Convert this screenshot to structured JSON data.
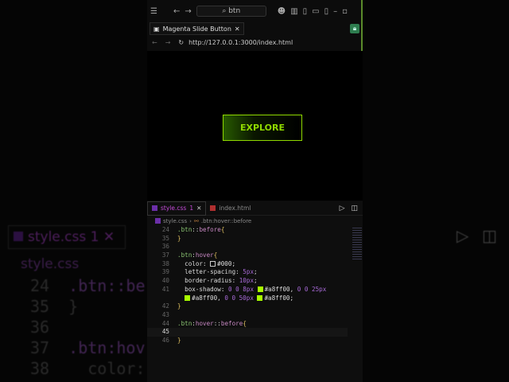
{
  "window": {
    "search": "btn",
    "tab_title": "Magenta Slide Button",
    "url": "http://127.0.0.1:3000/index.html"
  },
  "page": {
    "button_label": "EXPLORE",
    "accent": "#a8ff00"
  },
  "editor": {
    "tabs": [
      {
        "label": "style.css",
        "badge": "1"
      },
      {
        "label": "index.html"
      }
    ],
    "breadcrumb": {
      "file": "style.css",
      "symbol": ".btn:hover::before"
    },
    "lines": [
      {
        "num": "24",
        "tokens": [
          {
            "t": ".btn",
            "c": "#88c070"
          },
          {
            "t": "::",
            "c": "#ccc"
          },
          {
            "t": "before",
            "c": "#c586c0"
          },
          {
            "t": "{",
            "c": "#e0c060"
          }
        ]
      },
      {
        "num": "35",
        "tokens": [
          {
            "t": "}",
            "c": "#e0c060"
          }
        ]
      },
      {
        "num": "36",
        "tokens": []
      },
      {
        "num": "37",
        "tokens": [
          {
            "t": ".btn",
            "c": "#88c070"
          },
          {
            "t": ":",
            "c": "#ccc"
          },
          {
            "t": "hover",
            "c": "#c586c0"
          },
          {
            "t": "{",
            "c": "#e0c060"
          }
        ]
      },
      {
        "num": "38",
        "tokens": [
          {
            "t": "  color: ",
            "c": "#ddd"
          },
          {
            "sw": "#000000"
          },
          {
            "t": "#000",
            "c": "#ddd"
          },
          {
            "t": ";",
            "c": "#ddd"
          }
        ]
      },
      {
        "num": "39",
        "tokens": [
          {
            "t": "  letter-spacing: ",
            "c": "#ddd"
          },
          {
            "t": "5px",
            "c": "#a86ad8"
          },
          {
            "t": ";",
            "c": "#ddd"
          }
        ]
      },
      {
        "num": "40",
        "tokens": [
          {
            "t": "  border-radius: ",
            "c": "#ddd"
          },
          {
            "t": "10px",
            "c": "#a86ad8"
          },
          {
            "t": ";",
            "c": "#ddd"
          }
        ]
      },
      {
        "num": "41",
        "tokens": [
          {
            "t": "  box-shadow: ",
            "c": "#ddd"
          },
          {
            "t": "0 0 8px ",
            "c": "#a86ad8"
          },
          {
            "sw": "#a8ff00"
          },
          {
            "t": "#a8ff00, ",
            "c": "#ddd"
          },
          {
            "t": "0 0 25px",
            "c": "#a86ad8"
          }
        ]
      },
      {
        "num": "",
        "tokens": [
          {
            "t": "  ",
            "c": "#ddd"
          },
          {
            "sw": "#a8ff00"
          },
          {
            "t": "#a8ff00, ",
            "c": "#ddd"
          },
          {
            "t": "0 0 50px ",
            "c": "#a86ad8"
          },
          {
            "sw": "#a8ff00"
          },
          {
            "t": "#a8ff00;",
            "c": "#ddd"
          }
        ]
      },
      {
        "num": "42",
        "tokens": [
          {
            "t": "}",
            "c": "#e0c060"
          }
        ]
      },
      {
        "num": "43",
        "tokens": []
      },
      {
        "num": "44",
        "tokens": [
          {
            "t": ".btn",
            "c": "#88c070"
          },
          {
            "t": ":",
            "c": "#ccc"
          },
          {
            "t": "hover",
            "c": "#c586c0"
          },
          {
            "t": "::",
            "c": "#ccc"
          },
          {
            "t": "before",
            "c": "#c586c0"
          },
          {
            "t": "{",
            "c": "#e0c060"
          }
        ]
      },
      {
        "num": "45",
        "tokens": [],
        "current": true
      },
      {
        "num": "46",
        "tokens": [
          {
            "t": "}",
            "c": "#e0c060"
          }
        ]
      }
    ]
  }
}
